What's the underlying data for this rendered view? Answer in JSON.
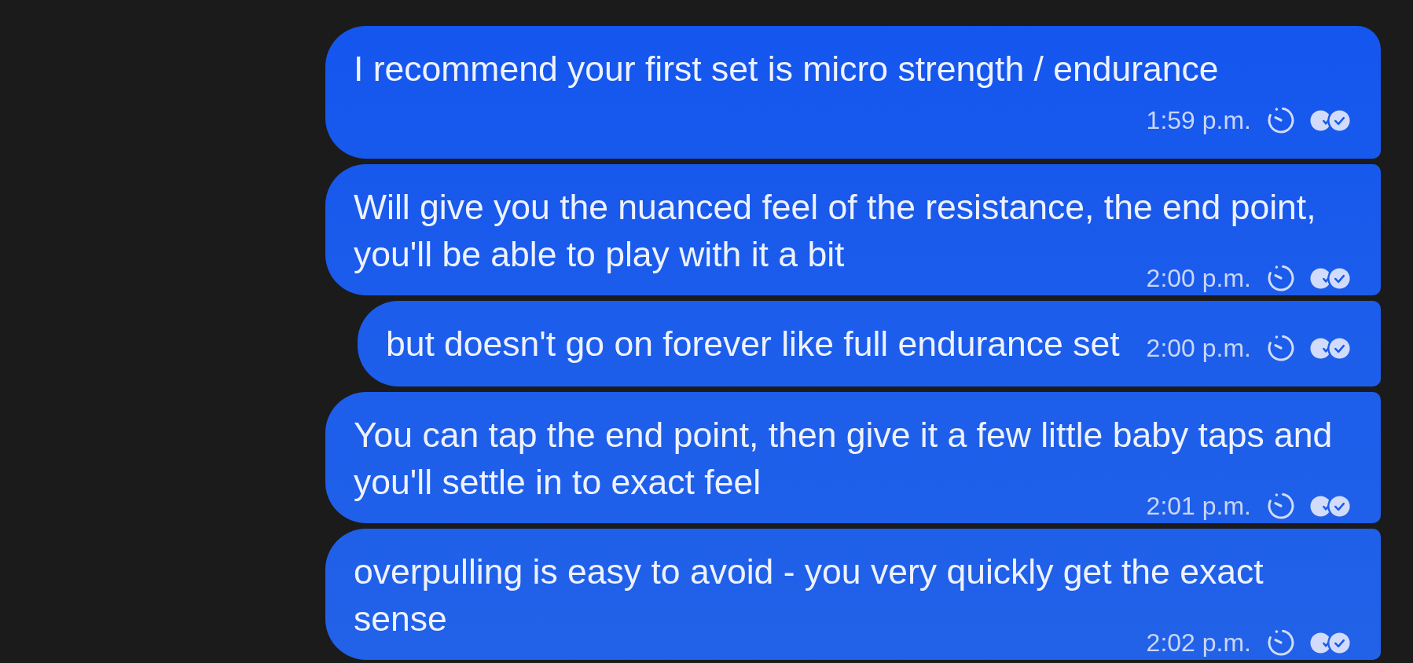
{
  "messages": [
    {
      "text": "I recommend your first set is micro strength / endurance",
      "time": "1:59 p.m.",
      "timer": true,
      "read": true
    },
    {
      "text": "Will give you the nuanced feel of the resistance, the end point, you'll be able to play with it a bit",
      "time": "2:00 p.m.",
      "timer": true,
      "read": true
    },
    {
      "text": "but doesn't go on forever like full endurance set",
      "time": "2:00 p.m.",
      "timer": true,
      "read": true
    },
    {
      "text": "You can tap the end point, then give it a few little baby taps and you'll settle in to exact feel",
      "time": "2:01 p.m.",
      "timer": true,
      "read": true
    },
    {
      "text": "overpulling is easy to avoid - you very quickly get the exact sense",
      "time": "2:02 p.m.",
      "timer": true,
      "read": true
    }
  ]
}
